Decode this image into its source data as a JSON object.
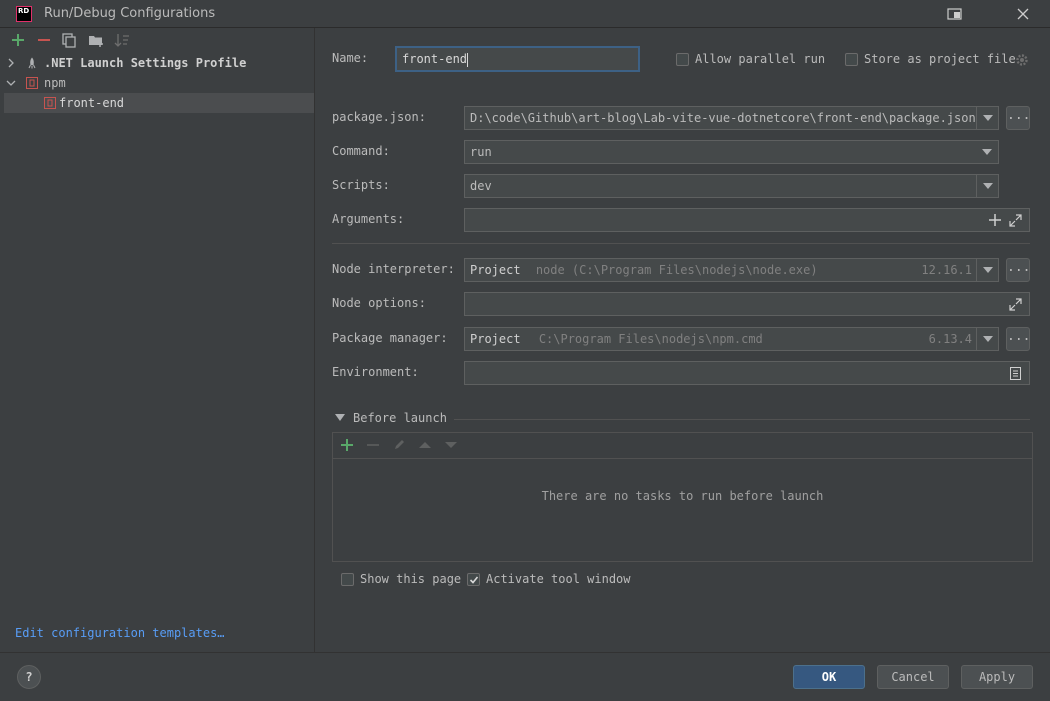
{
  "window": {
    "title": "Run/Debug Configurations",
    "logo_text": "RD"
  },
  "tree": {
    "items": [
      {
        "label": ".NET Launch Settings Profile"
      },
      {
        "label": "npm"
      },
      {
        "label": "front-end"
      }
    ]
  },
  "edit_templates_link": "Edit configuration templates…",
  "form": {
    "name_label": "Name:",
    "name_value": "front-end",
    "allow_parallel_label": "Allow parallel run",
    "store_as_project_label": "Store as project file",
    "package_json_label": "package.json:",
    "package_json_value": "D:\\code\\Github\\art-blog\\Lab-vite-vue-dotnetcore\\front-end\\package.json",
    "command_label": "Command:",
    "command_value": "run",
    "scripts_label": "Scripts:",
    "scripts_value": "dev",
    "arguments_label": "Arguments:",
    "node_interpreter_label": "Node interpreter:",
    "node_interpreter_prefix": "Project",
    "node_interpreter_path": "node (C:\\Program Files\\nodejs\\node.exe)",
    "node_interpreter_version": "12.16.1",
    "node_options_label": "Node options:",
    "package_manager_label": "Package manager:",
    "package_manager_prefix": "Project",
    "package_manager_path": "C:\\Program Files\\nodejs\\npm.cmd",
    "package_manager_version": "6.13.4",
    "environment_label": "Environment:",
    "dots": "..."
  },
  "before_launch": {
    "title": "Before launch",
    "empty_text": "There are no tasks to run before launch"
  },
  "options": {
    "show_this_page_label": "Show this page",
    "show_this_page_checked": false,
    "activate_tool_window_label": "Activate tool window",
    "activate_tool_window_checked": true
  },
  "footer": {
    "help_label": "?",
    "ok_label": "OK",
    "cancel_label": "Cancel",
    "apply_label": "Apply"
  },
  "colors": {
    "accent": "#365880",
    "add_green": "#59a869",
    "remove_red": "#c75450",
    "link": "#589df6"
  }
}
